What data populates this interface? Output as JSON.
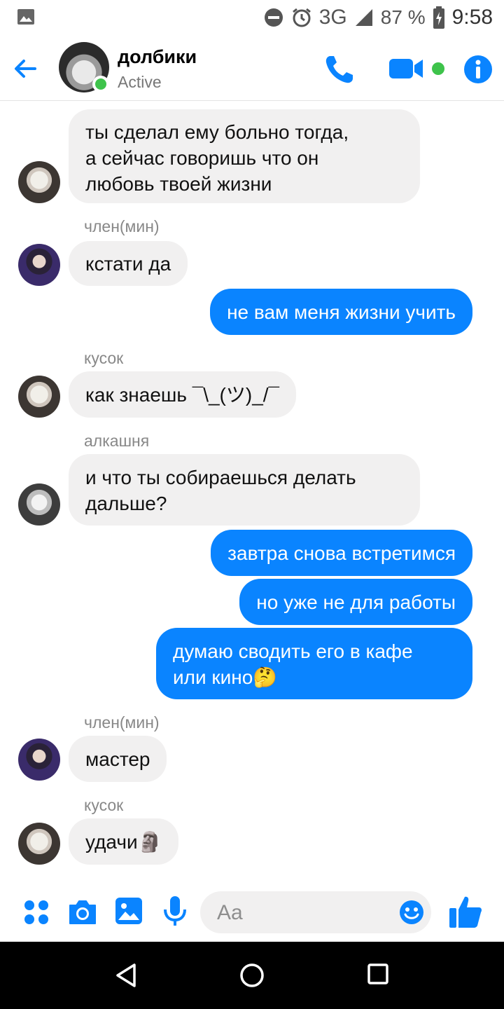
{
  "status_bar": {
    "network": "3G",
    "battery": "87 %",
    "time": "9:58",
    "icons": [
      "gallery-icon",
      "dnd-icon",
      "alarm-icon",
      "signal-icon",
      "battery-charging-icon"
    ]
  },
  "header": {
    "title": "долбики",
    "subtitle": "Active",
    "icons": [
      "back-arrow-icon",
      "phone-icon",
      "video-icon",
      "info-icon"
    ],
    "accent": "#0a84ff",
    "online_color": "#3ec34b"
  },
  "messages": [
    {
      "direction": "in",
      "sender": "",
      "lines": [
        "ты сделал ему больно тогда,",
        "а сейчас говоришь что он",
        "любовь твоей жизни"
      ]
    },
    {
      "direction": "in",
      "sender": "член(мин)",
      "lines": [
        "кстати да"
      ]
    },
    {
      "direction": "out",
      "lines": [
        "не вам меня жизни учить"
      ]
    },
    {
      "direction": "in",
      "sender": "кусок",
      "lines": [
        "как знаешь ¯\\_(ツ)_/¯"
      ]
    },
    {
      "direction": "in",
      "sender": "алкашня",
      "lines": [
        "и что ты собираешься делать",
        "дальше?"
      ]
    },
    {
      "direction": "out",
      "lines": [
        "завтра снова встретимся"
      ]
    },
    {
      "direction": "out",
      "lines": [
        "но уже не для работы"
      ]
    },
    {
      "direction": "out",
      "lines": [
        "думаю сводить его в кафе",
        "или кино🤔"
      ]
    },
    {
      "direction": "in",
      "sender": "член(мин)",
      "lines": [
        "мастер"
      ]
    },
    {
      "direction": "in",
      "sender": "кусок",
      "lines": [
        "удачи🗿"
      ]
    }
  ],
  "composer": {
    "placeholder": "Aa",
    "icons": [
      "apps-icon",
      "camera-icon",
      "image-icon",
      "mic-icon",
      "emoji-icon",
      "thumbs-up-icon"
    ]
  },
  "nav": {
    "icons": [
      "back-triangle-icon",
      "home-circle-icon",
      "recents-square-icon"
    ]
  }
}
